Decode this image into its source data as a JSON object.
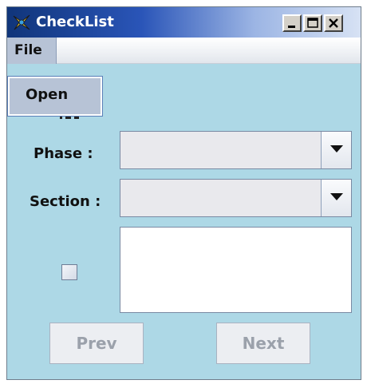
{
  "window": {
    "title": "CheckList"
  },
  "menubar": {
    "file_label": "File"
  },
  "file_menu": {
    "items": [
      {
        "label": "Open"
      }
    ]
  },
  "form": {
    "phase_label": "Phase :",
    "phase_value": "",
    "section_label": "Section :",
    "section_value": "",
    "item_checked": false,
    "item_text": ""
  },
  "buttons": {
    "prev_label": "Prev",
    "next_label": "Next"
  },
  "icons": {
    "app": "checklist-app-icon",
    "minimize": "minimize-icon",
    "maximize": "maximize-icon",
    "close": "close-icon",
    "dropdown": "chevron-down-icon"
  },
  "colors": {
    "background": "#add8e6",
    "title_start": "#10357a",
    "title_end": "#d7e2f4"
  }
}
